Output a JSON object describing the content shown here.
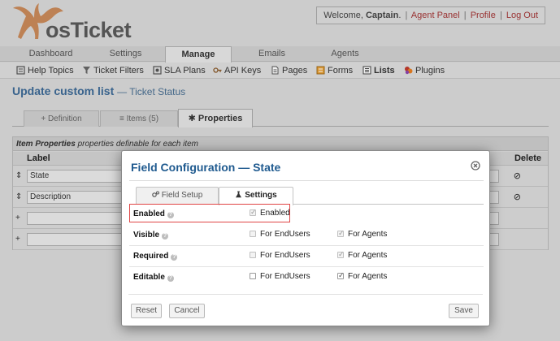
{
  "header": {
    "logo_text": "osTicket",
    "welcome_prefix": "Welcome, ",
    "user_name": "Captain",
    "welcome_period": ".",
    "links": [
      "Agent Panel",
      "Profile",
      "Log Out"
    ],
    "separator": "|"
  },
  "nav": {
    "tabs": [
      "Dashboard",
      "Settings",
      "Manage",
      "Emails",
      "Agents"
    ],
    "active": "Manage"
  },
  "subnav": {
    "items": [
      "Help Topics",
      "Ticket Filters",
      "SLA Plans",
      "API Keys",
      "Pages",
      "Forms",
      "Lists",
      "Plugins"
    ],
    "active": "Lists"
  },
  "page": {
    "title": "Update custom list",
    "subtitle": "— Ticket Status",
    "tabs": [
      {
        "label": "Definition",
        "icon": "plus-icon"
      },
      {
        "label": "Items (5)",
        "icon": "list-icon"
      },
      {
        "label": "Properties",
        "icon": "asterisk-icon"
      }
    ]
  },
  "props_table": {
    "caption_bold": "Item Properties",
    "caption_rest": " properties definable for each item",
    "col_label": "Label",
    "col_delete": "Delete",
    "rows": [
      {
        "label": "State",
        "handle": "⇕",
        "delete": "⊘"
      },
      {
        "label": "Description",
        "handle": "⇕",
        "delete": "⊘"
      },
      {
        "label": "",
        "handle": "+",
        "delete": ""
      },
      {
        "label": "",
        "handle": "+",
        "delete": ""
      }
    ]
  },
  "modal": {
    "title": "Field Configuration — State",
    "tabs": [
      {
        "label": "Field Setup",
        "icon": "gears-icon"
      },
      {
        "label": "Settings",
        "icon": "flask-icon"
      }
    ],
    "active_tab": "Settings",
    "fields": [
      {
        "name": "Enabled",
        "options": [
          {
            "label": "Enabled",
            "checked": true,
            "disabled": true
          }
        ]
      },
      {
        "name": "Visible",
        "options": [
          {
            "label": "For EndUsers",
            "checked": false,
            "disabled": true
          },
          {
            "label": "For Agents",
            "checked": true,
            "disabled": true
          }
        ]
      },
      {
        "name": "Required",
        "options": [
          {
            "label": "For EndUsers",
            "checked": false,
            "disabled": true
          },
          {
            "label": "For Agents",
            "checked": true,
            "disabled": true
          }
        ]
      },
      {
        "name": "Editable",
        "options": [
          {
            "label": "For EndUsers",
            "checked": false,
            "disabled": false
          },
          {
            "label": "For Agents",
            "checked": true,
            "disabled": false
          }
        ]
      }
    ],
    "buttons": {
      "reset": "Reset",
      "cancel": "Cancel",
      "save": "Save"
    }
  },
  "colors": {
    "title_blue": "#1f5a8f",
    "link_red": "#a33636",
    "highlight": "#e04545"
  }
}
